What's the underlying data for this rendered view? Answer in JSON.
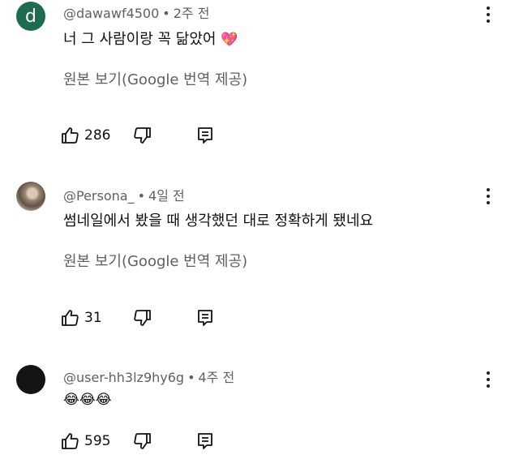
{
  "comments": [
    {
      "avatar_letter": "d",
      "handle": "@dawawf4500",
      "separator": "•",
      "time": "2주 전",
      "text": "너 그 사람이랑 꼭 닮았어",
      "text_emoji": "💖",
      "translate_link": "원본 보기(Google 번역 제공)",
      "likes": "286"
    },
    {
      "handle": "@Persona_",
      "separator": "•",
      "time": "4일 전",
      "text": "썸네일에서 봤을 때 생각했던 대로 정확하게 됐네요",
      "translate_link": "원본 보기(Google 번역 제공)",
      "likes": "31"
    },
    {
      "handle": "@user-hh3lz9hy6g",
      "separator": "•",
      "time": "4주 전",
      "text_emoji": "😂😂😂",
      "likes": "595"
    }
  ],
  "icons": {
    "like": "thumbs-up-icon",
    "dislike": "thumbs-down-icon",
    "reply": "reply-icon",
    "more": "more-vert-icon"
  }
}
